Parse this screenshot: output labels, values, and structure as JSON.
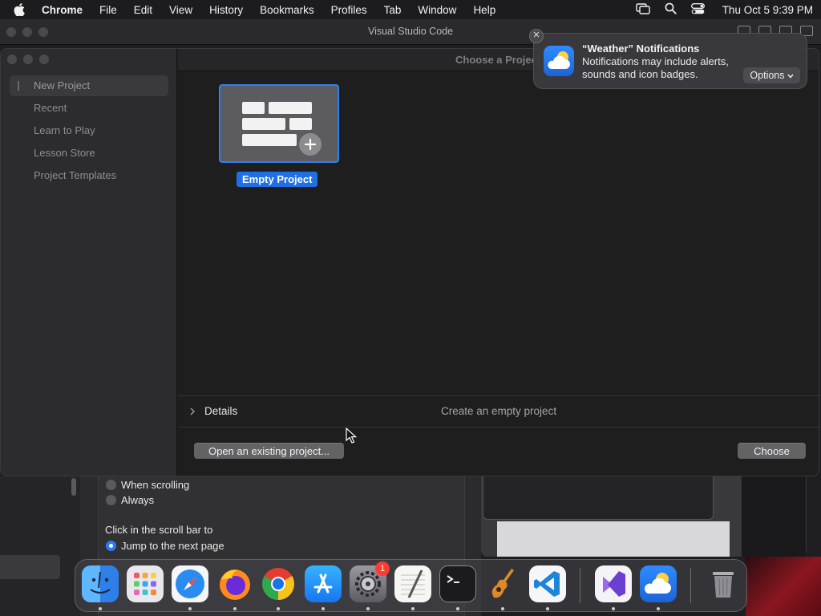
{
  "menubar": {
    "app": "Chrome",
    "items": [
      "File",
      "Edit",
      "View",
      "History",
      "Bookmarks",
      "Profiles",
      "Tab",
      "Window",
      "Help"
    ],
    "clock": "Thu Oct 5  9:39 PM",
    "status_icons": [
      "screen-mirroring-icon",
      "spotlight-search-icon",
      "control-center-icon"
    ]
  },
  "vscode": {
    "title": "Visual Studio Code"
  },
  "dialog": {
    "title": "Choose a Project",
    "sidebar": [
      "New Project",
      "Recent",
      "Learn to Play",
      "Lesson Store",
      "Project Templates"
    ],
    "template": {
      "label": "Empty Project"
    },
    "details": {
      "label": "Details",
      "description": "Create an empty project"
    },
    "buttons": {
      "open": "Open an existing project...",
      "choose": "Choose"
    }
  },
  "notification": {
    "title": "“Weather” Notifications",
    "body": "Notifications may include alerts, sounds and icon badges.",
    "options": "Options"
  },
  "background_settings": {
    "radio_options_1": [
      {
        "label": "When scrolling",
        "selected": false
      },
      {
        "label": "Always",
        "selected": false
      }
    ],
    "section": "Click in the scroll bar to",
    "radio_options_2": [
      {
        "label": "Jump to the next page",
        "selected": true
      }
    ]
  },
  "dock": {
    "apps": [
      "finder",
      "launchpad",
      "safari",
      "firefox",
      "chrome",
      "app-store",
      "system-settings",
      "textedit",
      "terminal",
      "garageband",
      "vscode",
      "visual-studio",
      "weather",
      "trash"
    ],
    "badges": {
      "system-settings": "1"
    }
  },
  "colors": {
    "accent": "#2e7ff2",
    "selection_label": "#1f6fe5"
  }
}
